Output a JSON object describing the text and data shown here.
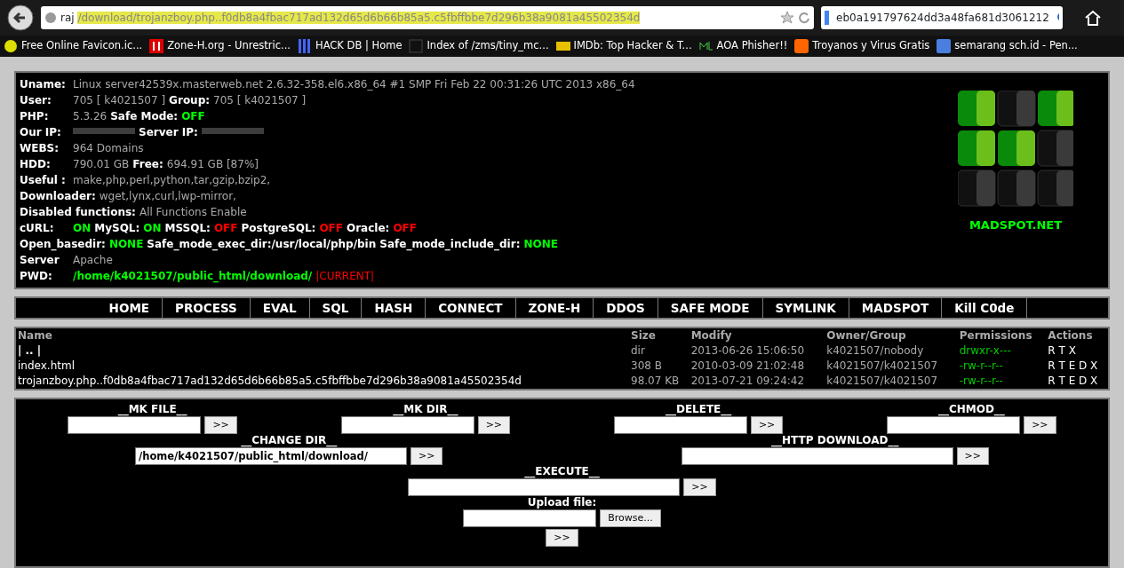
{
  "browser": {
    "url_start": "raj",
    "url": "/download/trojanzboy.php..f0db8a4fbac717ad132d65d6b66b85a5.c5fbffbbe7d296b38a9081a45502354d",
    "search": "eb0a191797624dd3a48fa681d3061212",
    "bookmarks": [
      {
        "label": "Free Online Favicon.ic...",
        "kind": "star"
      },
      {
        "label": "Zone-H.org - Unrestric...",
        "kind": "h"
      },
      {
        "label": "HACK DB | Home",
        "kind": "bars"
      },
      {
        "label": "Index of /zms/tiny_mc...",
        "kind": "blank"
      },
      {
        "label": "IMDb: Top Hacker & T...",
        "kind": "imdb"
      },
      {
        "label": "AOA Phisher!!",
        "kind": "ml"
      },
      {
        "label": "Troyanos y Virus Gratis",
        "kind": "blog"
      },
      {
        "label": "semarang sch.id - Pen...",
        "kind": "g"
      }
    ]
  },
  "info": [
    [
      {
        "kind": "label",
        "text": "Uname:"
      },
      {
        "kind": "value",
        "text": "Linux server42539x.masterweb.net 2.6.32-358.el6.x86_64 #1 SMP Fri Feb 22 00:31:26 UTC 2013 x86_64"
      }
    ],
    [
      {
        "kind": "label",
        "text": "User:"
      },
      {
        "kind": "value",
        "text": "705 [ k4021507 ]"
      },
      {
        "kind": "label",
        "text": "Group:"
      },
      {
        "kind": "value",
        "text": "705 [ k4021507 ]"
      }
    ],
    [
      {
        "kind": "label",
        "text": "PHP:"
      },
      {
        "kind": "value",
        "text": "5.3.26"
      },
      {
        "kind": "label",
        "text": "Safe Mode:"
      },
      {
        "kind": "on",
        "text": "OFF"
      }
    ],
    [
      {
        "kind": "label",
        "text": "Our IP:"
      },
      {
        "kind": "redacted"
      },
      {
        "kind": "label",
        "text": "Server IP:"
      },
      {
        "kind": "redacted"
      }
    ],
    [
      {
        "kind": "label",
        "text": "WEBS:"
      },
      {
        "kind": "value",
        "text": "964 Domains"
      }
    ],
    [
      {
        "kind": "label",
        "text": "HDD:"
      },
      {
        "kind": "value",
        "text": "790.01 GB"
      },
      {
        "kind": "label",
        "text": "Free:"
      },
      {
        "kind": "value",
        "text": "694.91 GB [87%]"
      }
    ],
    [
      {
        "kind": "label",
        "text": "Useful :"
      },
      {
        "kind": "value",
        "text": "make,php,perl,python,tar,gzip,bzip2,"
      }
    ],
    [
      {
        "kind": "label",
        "text": "Downloader:"
      },
      {
        "kind": "value",
        "text": "wget,lynx,curl,lwp-mirror,"
      }
    ],
    [
      {
        "kind": "label",
        "text": "Disabled functions:"
      },
      {
        "kind": "value",
        "text": "All Functions Enable"
      }
    ],
    [
      {
        "kind": "label",
        "text": "cURL:"
      },
      {
        "kind": "on",
        "text": "ON"
      },
      {
        "kind": "label",
        "text": "MySQL:"
      },
      {
        "kind": "on",
        "text": "ON"
      },
      {
        "kind": "label",
        "text": "MSSQL:"
      },
      {
        "kind": "off",
        "text": "OFF"
      },
      {
        "kind": "label",
        "text": "PostgreSQL:"
      },
      {
        "kind": "off",
        "text": "OFF"
      },
      {
        "kind": "label",
        "text": "Oracle:"
      },
      {
        "kind": "off",
        "text": "OFF"
      }
    ],
    [
      {
        "kind": "label",
        "text": "Open_basedir:"
      },
      {
        "kind": "on",
        "text": "NONE"
      },
      {
        "kind": "label",
        "text": "Safe_mode_exec_dir:/usr/local/php/bin"
      },
      {
        "kind": "label",
        "text": "Safe_mode_include_dir:"
      },
      {
        "kind": "on",
        "text": "NONE"
      }
    ],
    [
      {
        "kind": "label",
        "text": "Server"
      },
      {
        "kind": "value",
        "text": "Apache"
      }
    ],
    [
      {
        "kind": "label",
        "text": "PWD:"
      },
      {
        "kind": "on",
        "text": "/home/k4021507/public_html/download/"
      },
      {
        "kind": "current",
        "text": "|CURRENT|"
      }
    ]
  ],
  "logo": {
    "text": "MADSPOT.NET",
    "cells": [
      {
        "lit": true
      },
      {
        "lit": false
      },
      {
        "lit": true
      },
      {
        "lit": true
      },
      {
        "lit": true
      },
      {
        "lit": false
      },
      {
        "lit": false
      },
      {
        "lit": false
      },
      {
        "lit": false
      }
    ]
  },
  "menu": [
    "HOME",
    "PROCESS",
    "EVAL",
    "SQL",
    "HASH",
    "CONNECT",
    "ZONE-H",
    "DDOS",
    "SAFE MODE",
    "SYMLINK",
    "MADSPOT",
    "Kill C0de"
  ],
  "files": {
    "columns": [
      "Name",
      "Size",
      "Modify",
      "Owner/Group",
      "Permissions",
      "Actions"
    ],
    "rows": [
      [
        "| .. |",
        "dir",
        "2013-06-26 15:06:50",
        "k4021507/nobody",
        "drwxr-x---",
        "R T X"
      ],
      [
        "index.html",
        "308 B",
        "2010-03-09 21:02:48",
        "k4021507/k4021507",
        "-rw-r--r--",
        "R T E D X"
      ],
      [
        "trojanzboy.php..f0db8a4fbac717ad132d65d6b66b85a5.c5fbffbbe7d296b38a9081a45502354d",
        "98.07 KB",
        "2013-07-21 09:24:42",
        "k4021507/k4021507",
        "-rw-r--r--",
        "R T E D X"
      ]
    ]
  },
  "forms": [
    [
      {
        "label": "__MK FILE__",
        "button": ">>",
        "wide": false
      },
      {
        "label": "__MK DIR__",
        "button": ">>",
        "wide": false
      },
      {
        "label": "__DELETE__",
        "button": ">>",
        "wide": false
      },
      {
        "label": "__CHMOD__",
        "button": ">>",
        "wide": false
      }
    ],
    [
      {
        "label": "__CHANGE DIR__",
        "value": "/home/k4021507/public_html/download/",
        "button": ">>",
        "wide": true
      },
      {
        "label": "__HTTP DOWNLOAD__",
        "button": ">>",
        "wide": true
      }
    ],
    [
      {
        "label": "__EXECUTE__",
        "button": ">>",
        "wide": true
      }
    ]
  ],
  "upload": {
    "label": "Upload file:",
    "browse": "Browse...",
    "button": ">>"
  }
}
